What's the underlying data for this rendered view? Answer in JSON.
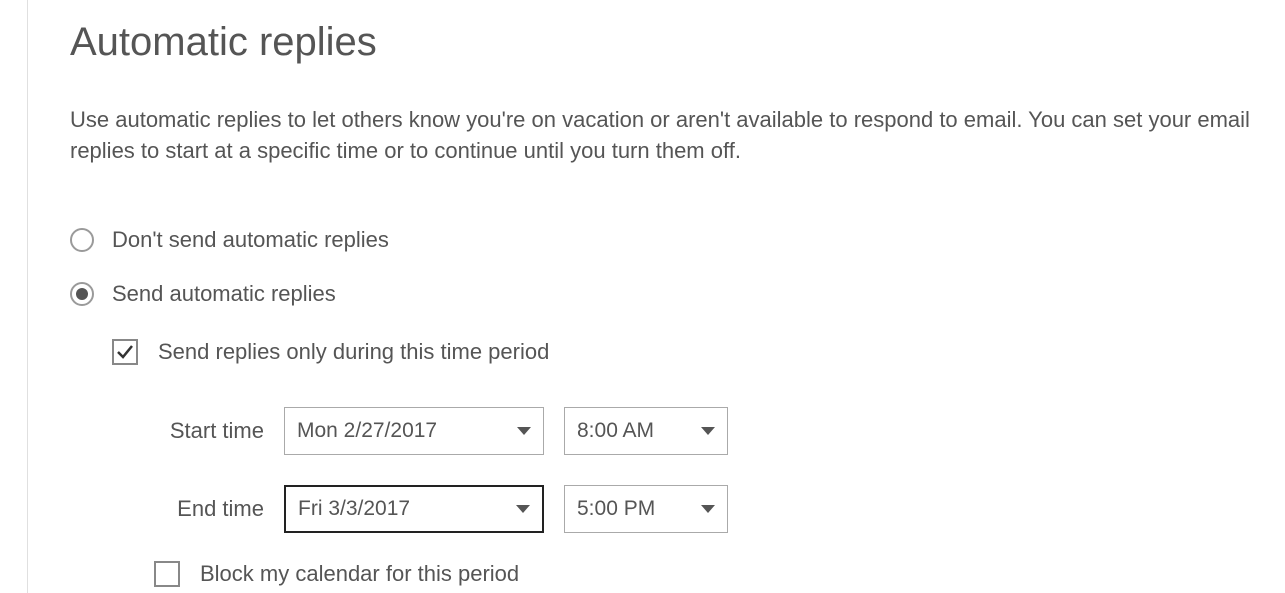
{
  "page_title": "Automatic replies",
  "description": "Use automatic replies to let others know you're on vacation or aren't available to respond to email. You can set your email replies to start at a specific time or to continue until you turn them off.",
  "radios": {
    "dont_send_label": "Don't send automatic replies",
    "send_label": "Send automatic replies",
    "selected": "send"
  },
  "send_only_period": {
    "label": "Send replies only during this time period",
    "checked": true
  },
  "start_time": {
    "label": "Start time",
    "date": "Mon 2/27/2017",
    "time": "8:00 AM"
  },
  "end_time": {
    "label": "End time",
    "date": "Fri 3/3/2017",
    "time": "5:00 PM"
  },
  "block_calendar": {
    "label": "Block my calendar for this period",
    "checked": false
  }
}
